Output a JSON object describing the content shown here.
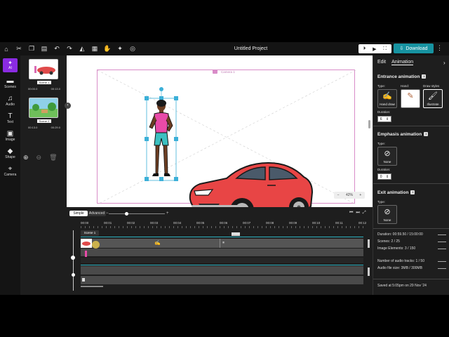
{
  "toolbar": {
    "icons": [
      "home-icon",
      "scissors-icon",
      "copy-icon",
      "paste-icon",
      "undo-icon",
      "redo-icon",
      "shape-icon",
      "grid-icon",
      "hand-icon",
      "pin-icon",
      "hide-icon"
    ],
    "project_title": "Untitled Project",
    "download_label": "Download"
  },
  "rail": {
    "ai_label": "AI",
    "items": [
      {
        "label": "Scenes",
        "glyph": "🎬"
      },
      {
        "label": "Audio",
        "glyph": "♫"
      },
      {
        "label": "Text",
        "glyph": "T"
      },
      {
        "label": "Image",
        "glyph": "▣"
      },
      {
        "label": "Shape",
        "glyph": "◆"
      },
      {
        "label": "Camera",
        "glyph": "⌖"
      }
    ]
  },
  "scenes": [
    {
      "label": "Scene 1",
      "start": "00:00.0",
      "end": "00:13.0"
    },
    {
      "label": "Scene 2",
      "start": "00:13.0",
      "end": "00:29.0"
    }
  ],
  "canvas": {
    "camera_label": "Camera 1",
    "zoom_minus": "−",
    "zoom_value": "42%",
    "zoom_plus": "+"
  },
  "panel": {
    "tab_edit": "Edit",
    "tab_animation": "Animation",
    "entrance_heading": "Entrance animation",
    "type_label": "Type:",
    "hand_label": "Hand:",
    "draw_styles_label": "Draw styles",
    "entrance_type": "Hand draw",
    "draw_style": "Illustrate",
    "duration_label": "Duration:",
    "entrance_duration": "6",
    "emphasis_heading": "Emphasis animation",
    "emphasis_type": "None",
    "emphasis_duration": "0",
    "exit_heading": "Exit animation",
    "exit_type": "None",
    "stats": [
      "Duration: 00:59.50 / 15:00:00",
      "Scenes: 2 / 25",
      "Image Elements: 3 / 150",
      "Number of audio tracks: 1 / 50",
      "Audio file size: 3MB / 300MB"
    ],
    "saved": "Saved at 5:05pm on 29 Nov '24"
  },
  "timeline": {
    "mode_simple": "Simple",
    "mode_advanced": "Advanced",
    "ruler": [
      "00:00",
      "00:01",
      "00:02",
      "00:03",
      "00:04",
      "00:05",
      "00:06",
      "00:07",
      "00:08",
      "00:09",
      "00:10",
      "00:11",
      "00:12"
    ],
    "scene_tab": "Scene 1"
  }
}
